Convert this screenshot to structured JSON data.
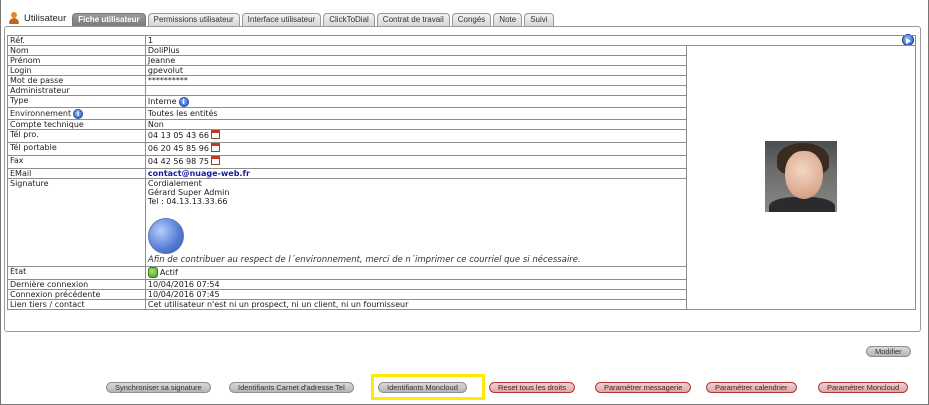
{
  "header": {
    "title": "Utilisateur",
    "tabs": [
      {
        "label": "Fiche utilisateur",
        "active": true
      },
      {
        "label": "Permissions utilisateur",
        "active": false
      },
      {
        "label": "Interface utilisateur",
        "active": false
      },
      {
        "label": "ClickToDial",
        "active": false
      },
      {
        "label": "Contrat de travail",
        "active": false
      },
      {
        "label": "Congés",
        "active": false
      },
      {
        "label": "Note",
        "active": false
      },
      {
        "label": "Suivi",
        "active": false
      }
    ]
  },
  "fields": {
    "ref": {
      "label": "Réf.",
      "value": "1"
    },
    "nom": {
      "label": "Nom",
      "value": "DoliPlus"
    },
    "prenom": {
      "label": "Prénom",
      "value": "Jeanne"
    },
    "login": {
      "label": "Login",
      "value": "gpevolut"
    },
    "password": {
      "label": "Mot de passe",
      "value": "**********"
    },
    "admin": {
      "label": "Administrateur",
      "value": ""
    },
    "type": {
      "label": "Type",
      "value": "Interne"
    },
    "environment": {
      "label": "Environnement",
      "value": "Toutes les entités"
    },
    "technical": {
      "label": "Compte technique",
      "value": "Non"
    },
    "tel_pro": {
      "label": "Tél pro.",
      "value": "04 13 05 43 66"
    },
    "tel_portable": {
      "label": "Tél portable",
      "value": "06 20 45 85 96"
    },
    "fax": {
      "label": "Fax",
      "value": "04 42 56 98 75"
    },
    "email": {
      "label": "EMail",
      "value": "contact@nuage-web.fr"
    },
    "signature": {
      "label": "Signature",
      "lines": [
        "Cordialement",
        "Gérard Super Admin",
        "Tel : 04.13.13.33.66"
      ],
      "note": "Afin de contribuer au respect de l´environnement, merci de n´imprimer ce courriel que si nécessaire."
    },
    "etat": {
      "label": "État",
      "value": "Actif"
    },
    "last_login": {
      "label": "Dernière connexion",
      "value": "10/04/2016 07:54"
    },
    "prev_login": {
      "label": "Connexion précédente",
      "value": "10/04/2016 07:45"
    },
    "third_party": {
      "label": "Lien tiers / contact",
      "value": "Cet utilisateur n'est ni un prospect, ni un client, ni un fournisseur"
    }
  },
  "actions": {
    "modify": "Modifier",
    "sync_signature": "Synchroniser sa signature",
    "carnet": "Identifiants Carnet d'adresse Tel",
    "moncloud": "Identifiants Moncloud",
    "reset_rights": "Reset tous les droits",
    "param_mail": "Paramétrer messagerie",
    "param_calendar": "Paramétrer calendrier",
    "param_moncloud": "Paramétrer Moncloud"
  },
  "icons": {
    "user": "user-icon",
    "next": "next-record-icon",
    "info": "info-icon",
    "calendar": "calendar-icon",
    "status": "status-active-icon"
  },
  "colors": {
    "active_tab": "#8a8a8a",
    "highlight": "#ffea00",
    "email_link": "#1a1a9c",
    "danger_border": "#b5363a"
  }
}
